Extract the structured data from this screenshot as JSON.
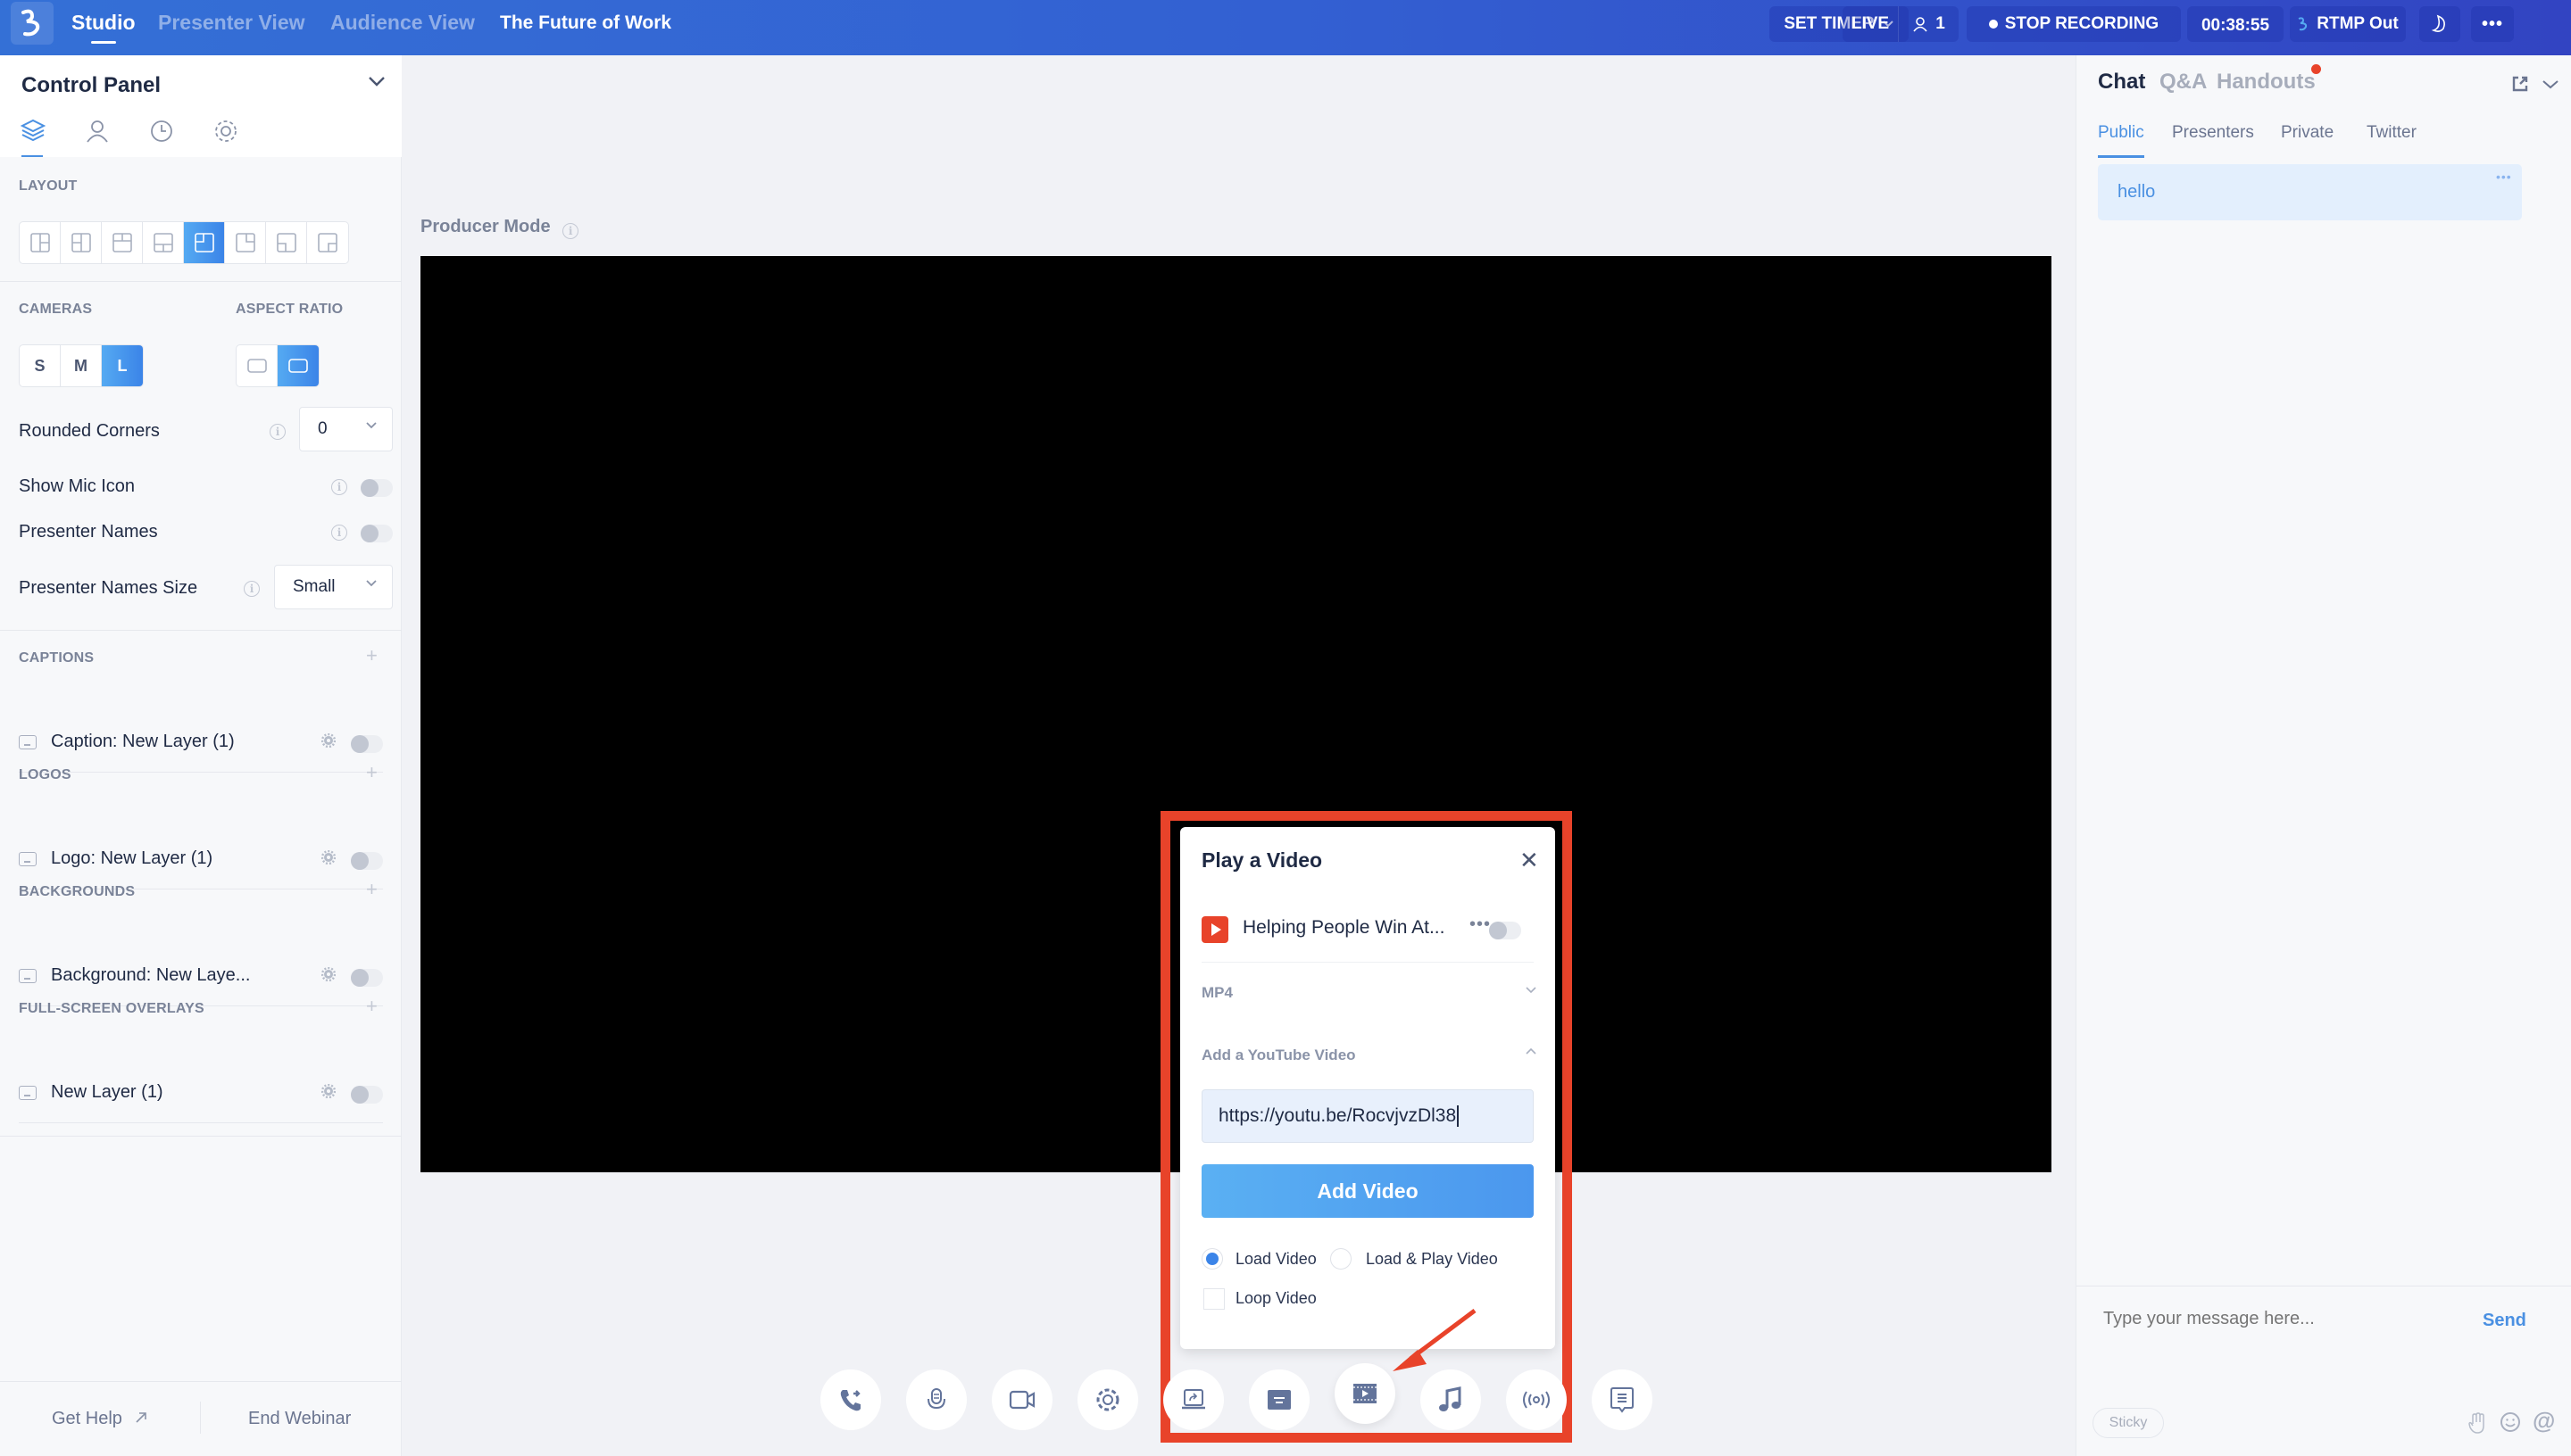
{
  "header": {
    "tabs": [
      {
        "label": "Studio",
        "active": true
      },
      {
        "label": "Presenter View",
        "active": false
      },
      {
        "label": "Audience View",
        "active": false
      }
    ],
    "event_title": "The Future of Work",
    "set_timer_label": "SET TIMER",
    "live_label": "LIVE",
    "attendee_count": "1",
    "stop_recording_label": "STOP RECORDING",
    "elapsed_time": "00:38:55",
    "rtmp_label": "RTMP Out",
    "brand_color": "#3360d2"
  },
  "control_panel": {
    "title": "Control Panel",
    "tabs": [
      "layers-icon",
      "person-icon",
      "history-icon",
      "settings-icon"
    ],
    "layout_label": "LAYOUT",
    "layout_options": 8,
    "layout_selected_index": 4,
    "cameras_label": "CAMERAS",
    "camera_sizes": [
      "S",
      "M",
      "L"
    ],
    "camera_selected": "L",
    "aspect_ratio_label": "ASPECT RATIO",
    "aspect_selected_index": 1,
    "rounded_corners": {
      "label": "Rounded Corners",
      "value": "0"
    },
    "show_mic_icon": {
      "label": "Show Mic Icon",
      "enabled": false
    },
    "presenter_names": {
      "label": "Presenter Names",
      "enabled": false
    },
    "presenter_names_size": {
      "label": "Presenter Names Size",
      "value": "Small"
    },
    "sections": [
      {
        "label": "CAPTIONS",
        "items": [
          {
            "name": "Caption: New Layer (1)",
            "enabled": false
          }
        ]
      },
      {
        "label": "LOGOS",
        "items": [
          {
            "name": "Logo: New Layer (1)",
            "enabled": false
          }
        ]
      },
      {
        "label": "BACKGROUNDS",
        "items": [
          {
            "name": "Background: New Laye...",
            "enabled": false
          }
        ]
      },
      {
        "label": "FULL-SCREEN OVERLAYS",
        "items": [
          {
            "name": "New Layer (1)",
            "enabled": false
          }
        ]
      }
    ],
    "footer": {
      "help_label": "Get Help",
      "end_label": "End Webinar"
    }
  },
  "stage": {
    "producer_mode_label": "Producer Mode"
  },
  "video_dialog": {
    "title": "Play a Video",
    "video_item": {
      "title": "Helping People Win At...",
      "enabled": false
    },
    "mp4_label": "MP4",
    "youtube_label": "Add a YouTube Video",
    "url_value": "https://youtu.be/RocvjvzDl38",
    "add_button_label": "Add Video",
    "options": [
      {
        "label": "Load Video",
        "selected": true
      },
      {
        "label": "Load & Play Video",
        "selected": false
      }
    ],
    "loop_label": "Loop Video",
    "loop_checked": false,
    "highlight_color": "#e8432a"
  },
  "toolbar": {
    "tools": [
      "phone-transfer-icon",
      "microphone-icon",
      "camera-icon",
      "settings-icon",
      "screen-share-icon",
      "caption-icon",
      "video-icon",
      "music-icon",
      "broadcast-icon",
      "chat-icon"
    ],
    "active_tool": "video-icon"
  },
  "chat": {
    "tabs": [
      {
        "label": "Chat",
        "active": true
      },
      {
        "label": "Q&A",
        "active": false
      },
      {
        "label": "Handouts",
        "active": false,
        "notification": true
      }
    ],
    "sub_tabs": [
      {
        "label": "Public",
        "active": true
      },
      {
        "label": "Presenters",
        "active": false
      },
      {
        "label": "Private",
        "active": false
      },
      {
        "label": "Twitter",
        "active": false
      }
    ],
    "messages": [
      {
        "text": "hello"
      }
    ],
    "input_placeholder": "Type your message here...",
    "send_label": "Send",
    "sticky_label": "Sticky"
  }
}
